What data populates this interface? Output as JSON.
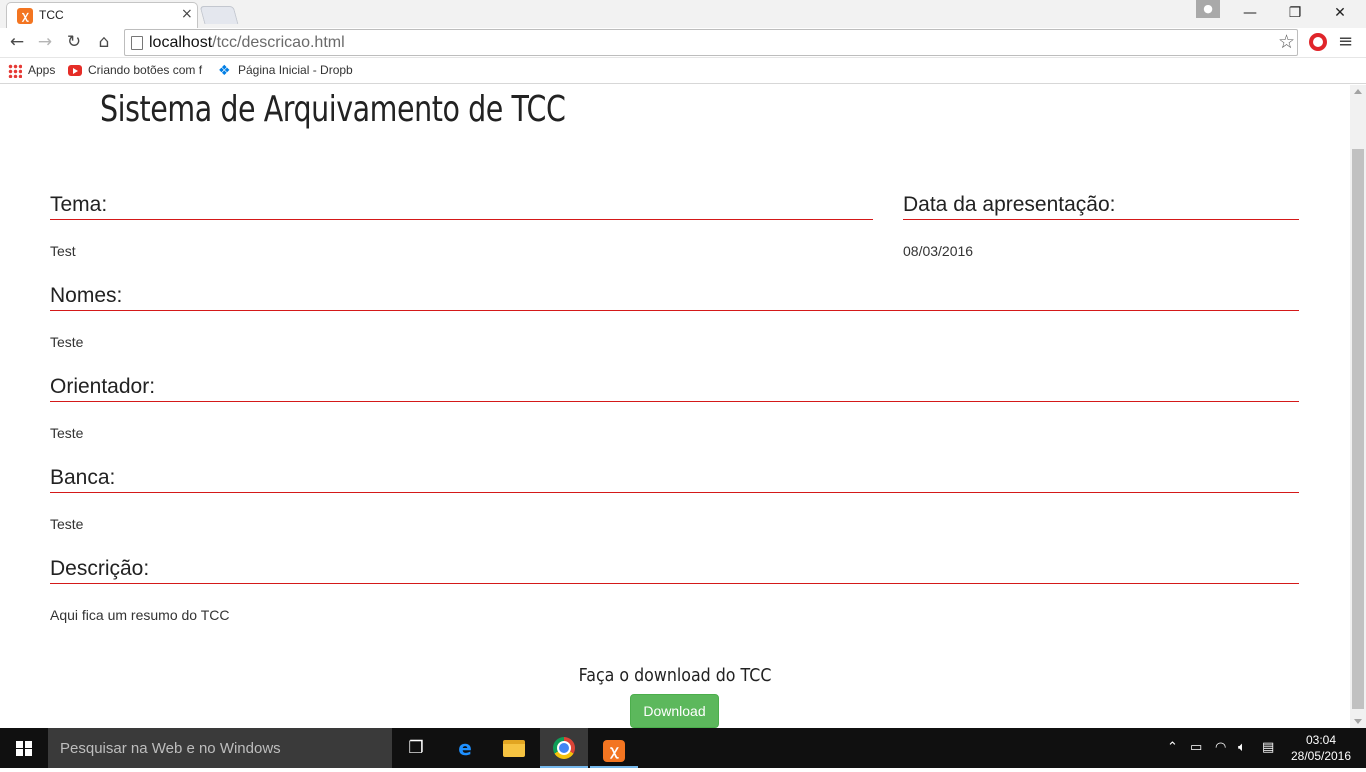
{
  "browser": {
    "tab_title": "TCC",
    "tab_close": "×",
    "url_host": "localhost",
    "url_path": "/tcc/descricao.html",
    "bookmarks": [
      {
        "label": "Apps"
      },
      {
        "label": "Criando botões com f"
      },
      {
        "label": "Página Inicial - Dropb"
      }
    ]
  },
  "page": {
    "title": "Sistema de Arquivamento de TCC",
    "fields": {
      "tema": {
        "label": "Tema:",
        "value": "Test"
      },
      "data": {
        "label": "Data da apresentação:",
        "value": "08/03/2016"
      },
      "nomes": {
        "label": "Nomes:",
        "value": "Teste"
      },
      "orientador": {
        "label": "Orientador:",
        "value": "Teste"
      },
      "banca": {
        "label": "Banca:",
        "value": "Teste"
      },
      "descricao": {
        "label": "Descrição:",
        "value": "Aqui fica um resumo do TCC"
      }
    },
    "download_prompt": "Faça o download do TCC",
    "download_button": "Download"
  },
  "taskbar": {
    "search_placeholder": "Pesquisar na Web e no Windows",
    "time": "03:04",
    "date": "28/05/2016"
  },
  "colors": {
    "accent_rule": "#d41919",
    "download_button": "#5cb85c"
  }
}
